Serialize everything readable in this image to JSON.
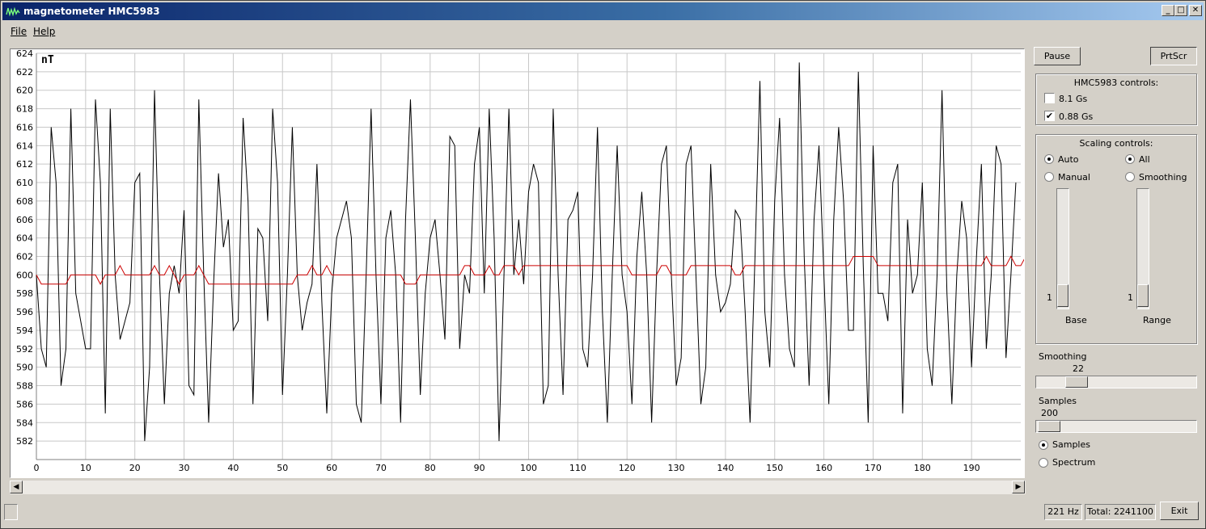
{
  "window": {
    "title": "magnetometer HMC5983",
    "min_glyph": "_",
    "max_glyph": "□",
    "close_glyph": "✕"
  },
  "menu": {
    "file": "File",
    "help": "Help"
  },
  "toolbar": {
    "pause_label": "Pause",
    "prtscr_label": "PrtScr"
  },
  "hmc_controls": {
    "title": "HMC5983 controls:",
    "options": [
      {
        "label": "8.1 Gs",
        "checked": false
      },
      {
        "label": "0.88 Gs",
        "checked": true
      }
    ]
  },
  "scaling": {
    "title": "Scaling controls:",
    "auto": "Auto",
    "manual": "Manual",
    "all": "All",
    "smoothing": "Smoothing",
    "mode_selected": "Auto",
    "range_mode_selected": "All",
    "base_value": "1",
    "base_label": "Base",
    "range_value": "1",
    "range_label": "Range"
  },
  "smoothing": {
    "label": "Smoothing",
    "value": "22"
  },
  "samples": {
    "label": "Samples",
    "value": "200",
    "view_samples": "Samples",
    "view_spectrum": "Spectrum",
    "view_selected": "Samples"
  },
  "status": {
    "rate": "221 Hz",
    "total": "Total: 2241100",
    "exit_label": "Exit"
  },
  "colors": {
    "raw_series": "#000000",
    "smoothed_series": "#cc0000",
    "grid": "#c8c8c8"
  },
  "chart_data": {
    "type": "line",
    "unit_label": "nT",
    "xlim": [
      0,
      200
    ],
    "ylim": [
      580,
      624
    ],
    "xticks": [
      0,
      10,
      20,
      30,
      40,
      50,
      60,
      70,
      80,
      90,
      100,
      110,
      120,
      130,
      140,
      150,
      160,
      170,
      180,
      190
    ],
    "yticks": [
      582,
      584,
      586,
      588,
      590,
      592,
      594,
      596,
      598,
      600,
      602,
      604,
      606,
      608,
      610,
      612,
      614,
      616,
      618,
      620,
      622,
      624
    ],
    "grid": true,
    "series": [
      {
        "color": "#000000",
        "values": [
          600,
          592,
          590,
          616,
          610,
          588,
          592,
          618,
          598,
          595,
          592,
          592,
          619,
          610,
          585,
          618,
          600,
          593,
          595,
          597,
          610,
          611,
          582,
          590,
          620,
          600,
          586,
          598,
          601,
          598,
          607,
          588,
          587,
          619,
          600,
          584,
          599,
          611,
          603,
          606,
          594,
          595,
          617,
          608,
          586,
          605,
          604,
          595,
          618,
          610,
          587,
          600,
          616,
          600,
          594,
          597,
          599,
          612,
          597,
          585,
          598,
          604,
          606,
          608,
          604,
          586,
          584,
          600,
          618,
          600,
          586,
          604,
          607,
          600,
          584,
          606,
          619,
          604,
          587,
          598,
          604,
          606,
          600,
          593,
          615,
          614,
          592,
          600,
          598,
          612,
          616,
          598,
          618,
          604,
          582,
          600,
          618,
          600,
          606,
          599,
          609,
          612,
          610,
          586,
          588,
          618,
          600,
          587,
          606,
          607,
          609,
          592,
          590,
          600,
          616,
          596,
          584,
          600,
          614,
          600,
          596,
          586,
          602,
          609,
          600,
          584,
          600,
          612,
          614,
          600,
          588,
          591,
          612,
          614,
          600,
          586,
          590,
          612,
          600,
          596,
          597,
          599,
          607,
          606,
          596,
          584,
          602,
          621,
          596,
          590,
          608,
          617,
          600,
          592,
          590,
          623,
          602,
          588,
          606,
          614,
          600,
          586,
          606,
          616,
          608,
          594,
          594,
          622,
          601,
          584,
          614,
          598,
          598,
          595,
          610,
          612,
          585,
          606,
          598,
          600,
          610,
          592,
          588,
          600,
          620,
          598,
          586,
          600,
          608,
          604,
          590,
          602,
          612,
          592,
          600,
          614,
          612,
          591,
          600,
          610
        ]
      },
      {
        "color": "#cc0000",
        "values": [
          600,
          599,
          599,
          599,
          599,
          599,
          599,
          600,
          600,
          600,
          600,
          600,
          600,
          599,
          600,
          600,
          600,
          601,
          600,
          600,
          600,
          600,
          600,
          600,
          601,
          600,
          600,
          601,
          600,
          599,
          600,
          600,
          600,
          601,
          600,
          599,
          599,
          599,
          599,
          599,
          599,
          599,
          599,
          599,
          599,
          599,
          599,
          599,
          599,
          599,
          599,
          599,
          599,
          600,
          600,
          600,
          601,
          600,
          600,
          601,
          600,
          600,
          600,
          600,
          600,
          600,
          600,
          600,
          600,
          600,
          600,
          600,
          600,
          600,
          600,
          599,
          599,
          599,
          600,
          600,
          600,
          600,
          600,
          600,
          600,
          600,
          600,
          601,
          601,
          600,
          600,
          600,
          601,
          600,
          600,
          601,
          601,
          601,
          600,
          601,
          601,
          601,
          601,
          601,
          601,
          601,
          601,
          601,
          601,
          601,
          601,
          601,
          601,
          601,
          601,
          601,
          601,
          601,
          601,
          601,
          601,
          600,
          600,
          600,
          600,
          600,
          600,
          601,
          601,
          600,
          600,
          600,
          600,
          601,
          601,
          601,
          601,
          601,
          601,
          601,
          601,
          601,
          600,
          600,
          601,
          601,
          601,
          601,
          601,
          601,
          601,
          601,
          601,
          601,
          601,
          601,
          601,
          601,
          601,
          601,
          601,
          601,
          601,
          601,
          601,
          601,
          602,
          602,
          602,
          602,
          602,
          601,
          601,
          601,
          601,
          601,
          601,
          601,
          601,
          601,
          601,
          601,
          601,
          601,
          601,
          601,
          601,
          601,
          601,
          601,
          601,
          601,
          601,
          602,
          601,
          601,
          601,
          601,
          602,
          601,
          601,
          602
        ]
      }
    ]
  }
}
